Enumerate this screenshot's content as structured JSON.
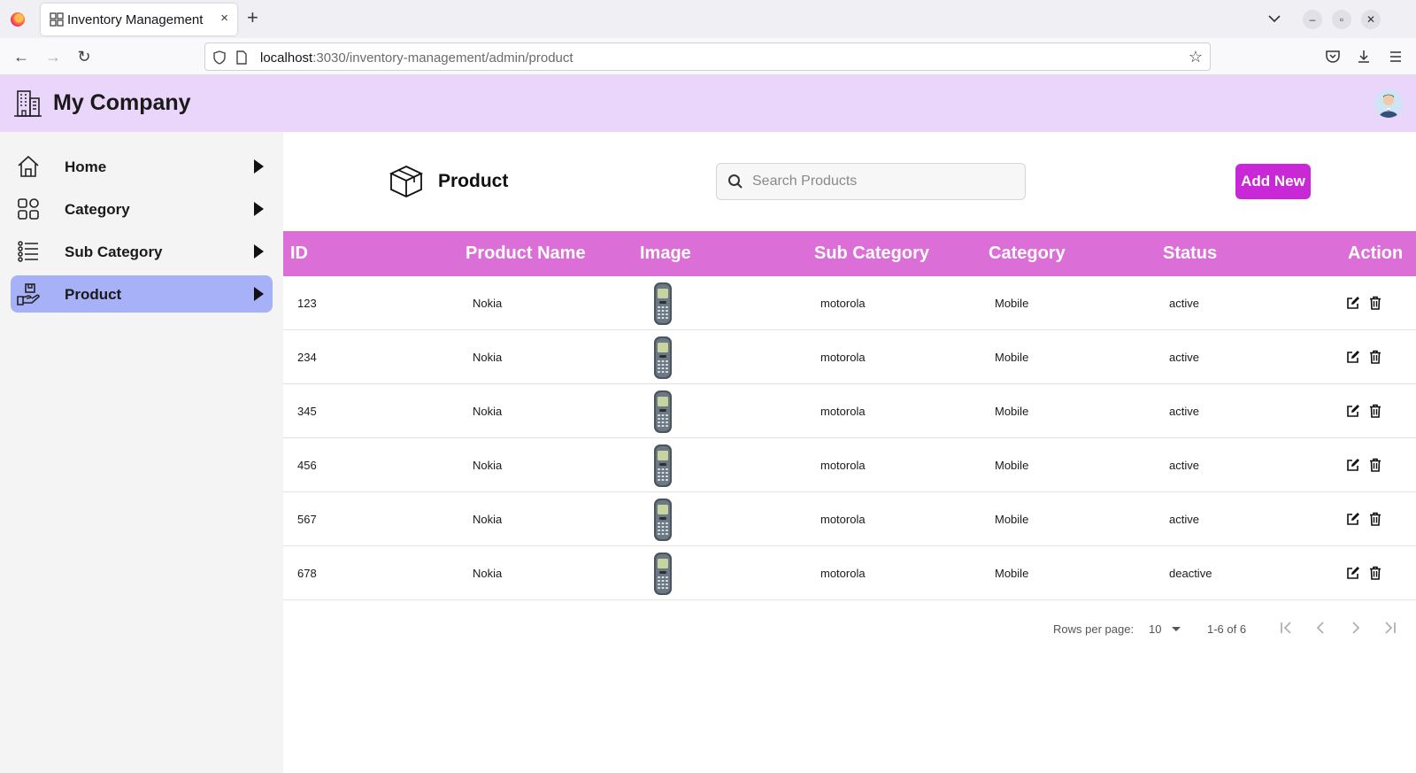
{
  "browser": {
    "tab_title": "Inventory Management",
    "tab_close": "×",
    "new_tab": "+",
    "url_host": "localhost",
    "url_path": ":3030/inventory-management/admin/product"
  },
  "header": {
    "company_name": "My Company"
  },
  "sidebar": {
    "items": [
      {
        "label": "Home",
        "icon": "home-icon",
        "active": false
      },
      {
        "label": "Category",
        "icon": "grid-icon",
        "active": false
      },
      {
        "label": "Sub Category",
        "icon": "list-icon",
        "active": false
      },
      {
        "label": "Product",
        "icon": "hand-box-icon",
        "active": true
      }
    ]
  },
  "main": {
    "title": "Product",
    "search_placeholder": "Search Products",
    "add_button": "Add New"
  },
  "table": {
    "columns": [
      "ID",
      "Product Name",
      "Image",
      "Sub Category",
      "Category",
      "Status",
      "Action"
    ],
    "rows": [
      {
        "id": "123",
        "name": "Nokia",
        "sub_category": "motorola",
        "category": "Mobile",
        "status": "active"
      },
      {
        "id": "234",
        "name": "Nokia",
        "sub_category": "motorola",
        "category": "Mobile",
        "status": "active"
      },
      {
        "id": "345",
        "name": "Nokia",
        "sub_category": "motorola",
        "category": "Mobile",
        "status": "active"
      },
      {
        "id": "456",
        "name": "Nokia",
        "sub_category": "motorola",
        "category": "Mobile",
        "status": "active"
      },
      {
        "id": "567",
        "name": "Nokia",
        "sub_category": "motorola",
        "category": "Mobile",
        "status": "active"
      },
      {
        "id": "678",
        "name": "Nokia",
        "sub_category": "motorola",
        "category": "Mobile",
        "status": "deactive"
      }
    ]
  },
  "pagination": {
    "rows_per_page_label": "Rows per page:",
    "rows_per_page_value": "10",
    "range": "1-6 of 6"
  },
  "colors": {
    "header_bg": "#ead5fb",
    "table_header": "#dc6ed8",
    "accent_button": "#c928d6",
    "active_nav": "#a6b1f7"
  }
}
